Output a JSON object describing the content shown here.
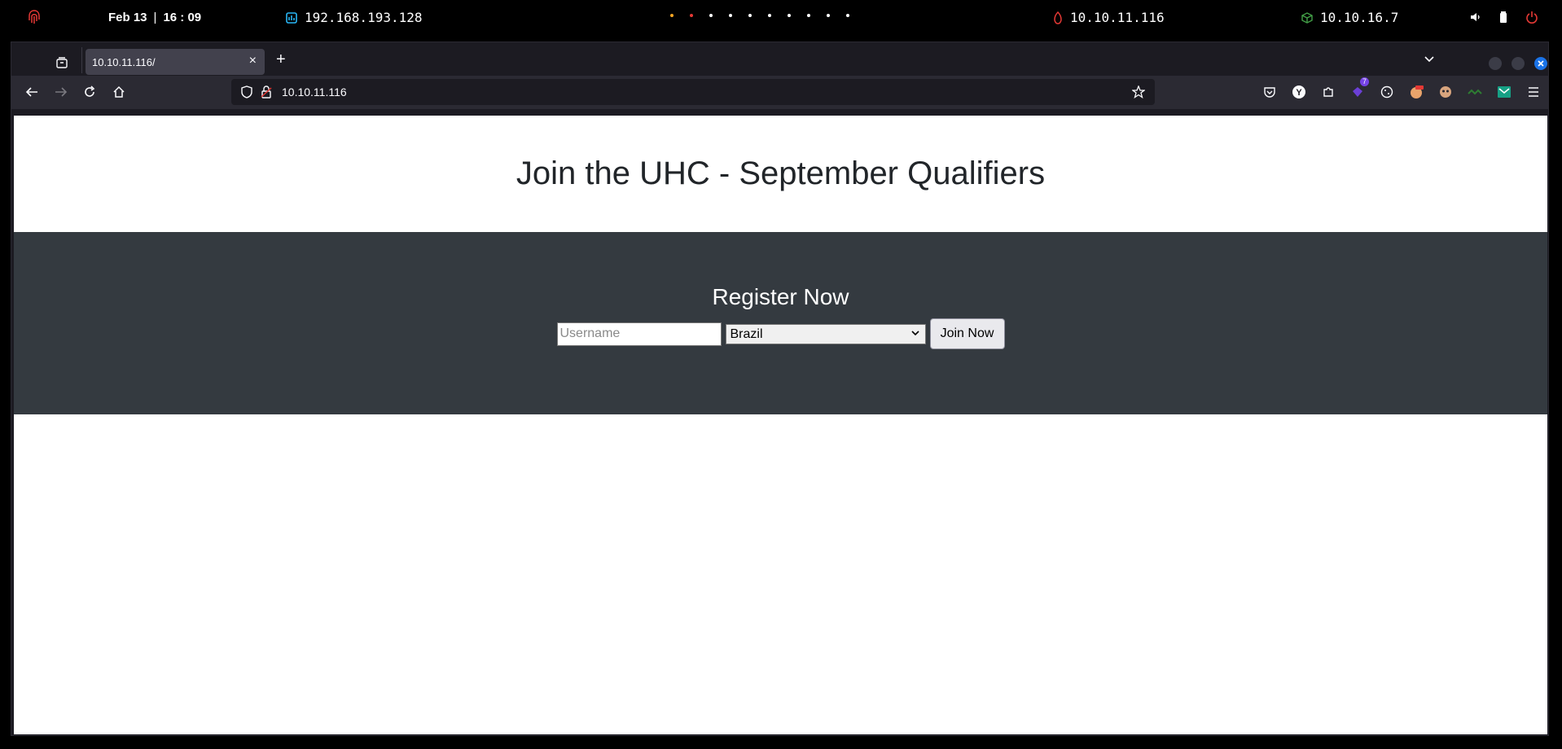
{
  "system_bar": {
    "date": "Feb 13",
    "separator": "|",
    "time": "16 : 09",
    "local_ip": "192.168.193.128",
    "target_ip": "10.10.11.116",
    "vpn_ip": "10.10.16.7",
    "workspace_dot_colors": [
      "#f5a623",
      "#e53935",
      "#ffffff",
      "#ffffff",
      "#ffffff",
      "#ffffff",
      "#ffffff",
      "#ffffff",
      "#ffffff",
      "#ffffff"
    ]
  },
  "browser": {
    "tab": {
      "title": "10.10.11.116/",
      "close": "×"
    },
    "new_tab": "+",
    "url": "10.10.11.116",
    "extension_badge": "7"
  },
  "page": {
    "title": "Join the UHC - September Qualifiers",
    "register_title": "Register Now",
    "username_placeholder": "Username",
    "country_selected": "Brazil",
    "join_button": "Join Now"
  },
  "colors": {
    "hero_bg": "#343a40",
    "accent_close": "#1a73e8"
  }
}
